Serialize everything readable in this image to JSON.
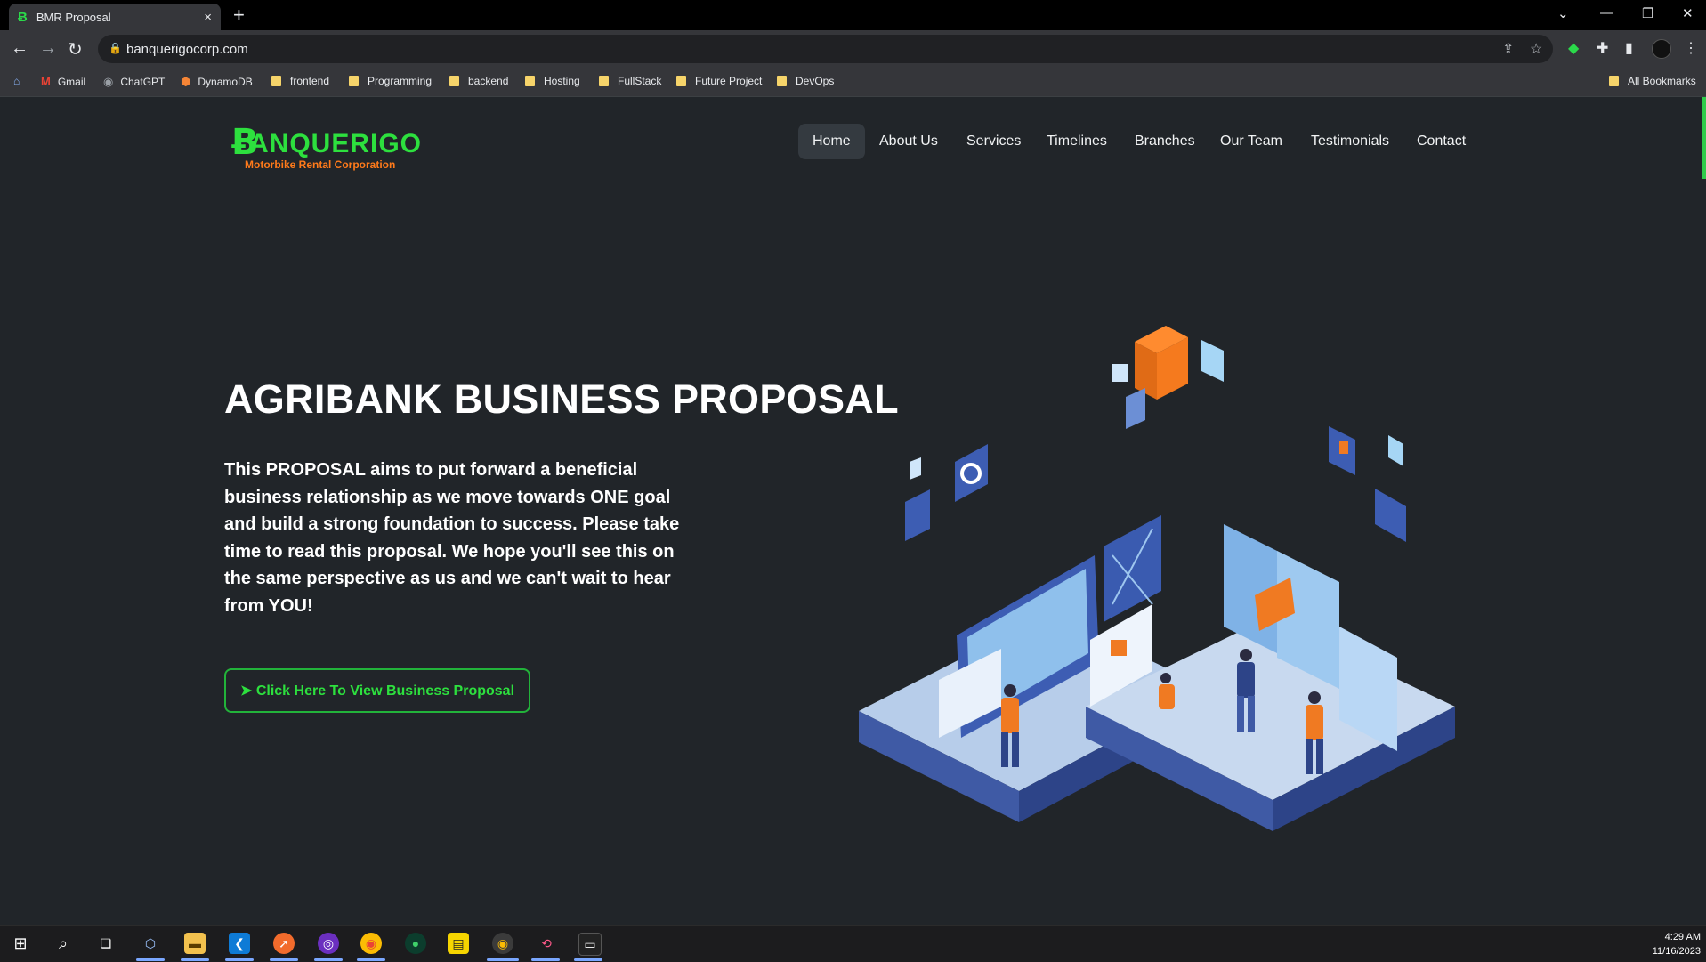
{
  "browser": {
    "tab_title": "BMR Proposal",
    "tab_close": "×",
    "new_tab": "+",
    "url": "banquerigocorp.com",
    "window_controls": [
      "⌄",
      "—",
      "❐",
      "✕"
    ],
    "bookmarks": [
      {
        "label": "Gmail",
        "icon": "gmail-icon"
      },
      {
        "label": "ChatGPT",
        "icon": "chatgpt-icon"
      },
      {
        "label": "DynamoDB",
        "icon": "dynamodb-icon"
      },
      {
        "label": "frontend",
        "icon": "folder-icon"
      },
      {
        "label": "Programming",
        "icon": "folder-icon"
      },
      {
        "label": "backend",
        "icon": "folder-icon"
      },
      {
        "label": "Hosting",
        "icon": "folder-icon"
      },
      {
        "label": "FullStack",
        "icon": "folder-icon"
      },
      {
        "label": "Future Project",
        "icon": "folder-icon"
      },
      {
        "label": "DevOps",
        "icon": "folder-icon"
      }
    ],
    "all_bookmarks": "All Bookmarks"
  },
  "site": {
    "logo": {
      "mark": "Ƀ",
      "name": "ANQUERIGO",
      "tagline": "Motorbike Rental Corporation"
    },
    "nav": [
      "Home",
      "About Us",
      "Services",
      "Timelines",
      "Branches",
      "Our Team",
      "Testimonials",
      "Contact"
    ],
    "active_nav": "Home",
    "hero": {
      "title": "AGRIBANK BUSINESS PROPOSAL",
      "text": "This PROPOSAL aims to put forward a beneficial business relationship as we move towards ONE goal and build a strong foundation to success. Please take time to read this proposal. We hope you'll see this on the same perspective as us and we can't wait to hear from YOU!",
      "cta": "➤ Click Here To View Business Proposal"
    }
  },
  "taskbar": {
    "time": "4:29 AM",
    "date": "11/16/2023"
  },
  "colors": {
    "accent_green": "#2de03e",
    "accent_orange": "#ff7a1a",
    "page_bg": "#212529"
  }
}
